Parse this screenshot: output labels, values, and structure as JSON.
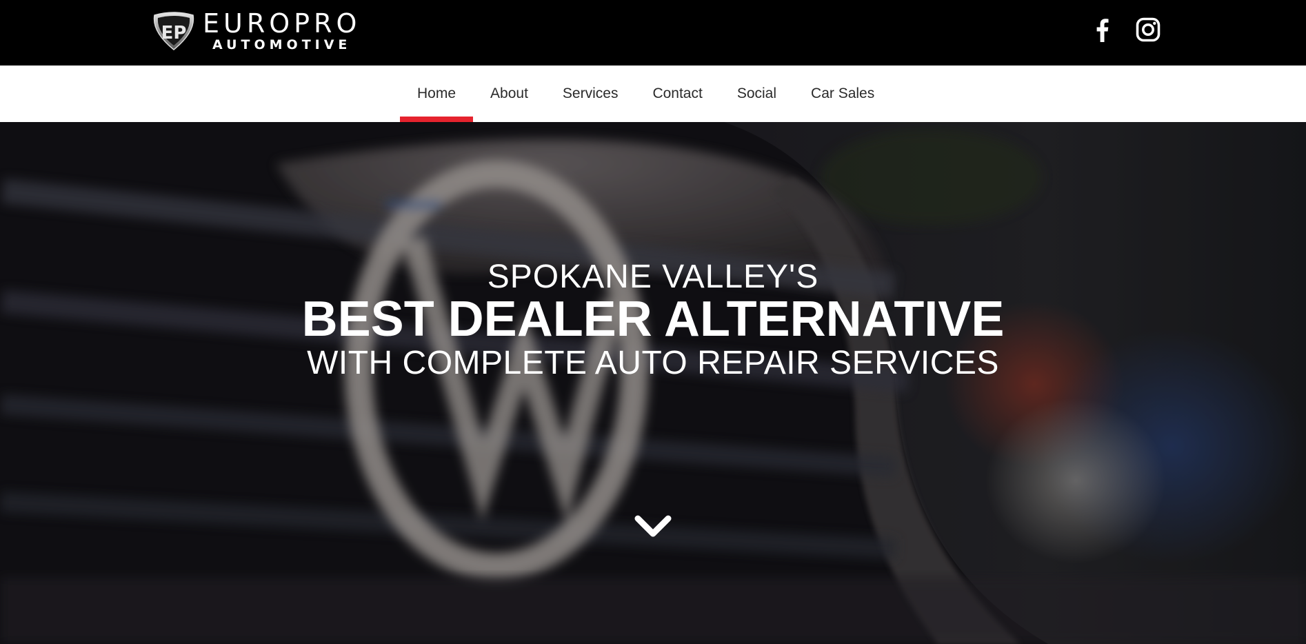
{
  "header": {
    "logo": {
      "brand": "EUROPRO",
      "sub": "AUTOMOTIVE",
      "icon": "ep-shield-logo"
    },
    "social": [
      {
        "name": "facebook",
        "icon": "facebook-icon"
      },
      {
        "name": "instagram",
        "icon": "instagram-icon"
      }
    ]
  },
  "nav": {
    "items": [
      {
        "label": "Home",
        "active": true
      },
      {
        "label": "About",
        "active": false
      },
      {
        "label": "Services",
        "active": false
      },
      {
        "label": "Contact",
        "active": false
      },
      {
        "label": "Social",
        "active": false
      },
      {
        "label": "Car Sales",
        "active": false
      }
    ]
  },
  "hero": {
    "line1": "SPOKANE VALLEY'S",
    "line2": "BEST DEALER ALTERNATIVE",
    "line3": "WITH COMPLETE AUTO REPAIR SERVICES",
    "scroll_icon": "chevron-down-icon"
  },
  "colors": {
    "accent": "#e5232e",
    "topbar_bg": "#000000",
    "nav_bg": "#ffffff",
    "nav_text": "#2a2a2a",
    "hero_text": "#ffffff"
  }
}
